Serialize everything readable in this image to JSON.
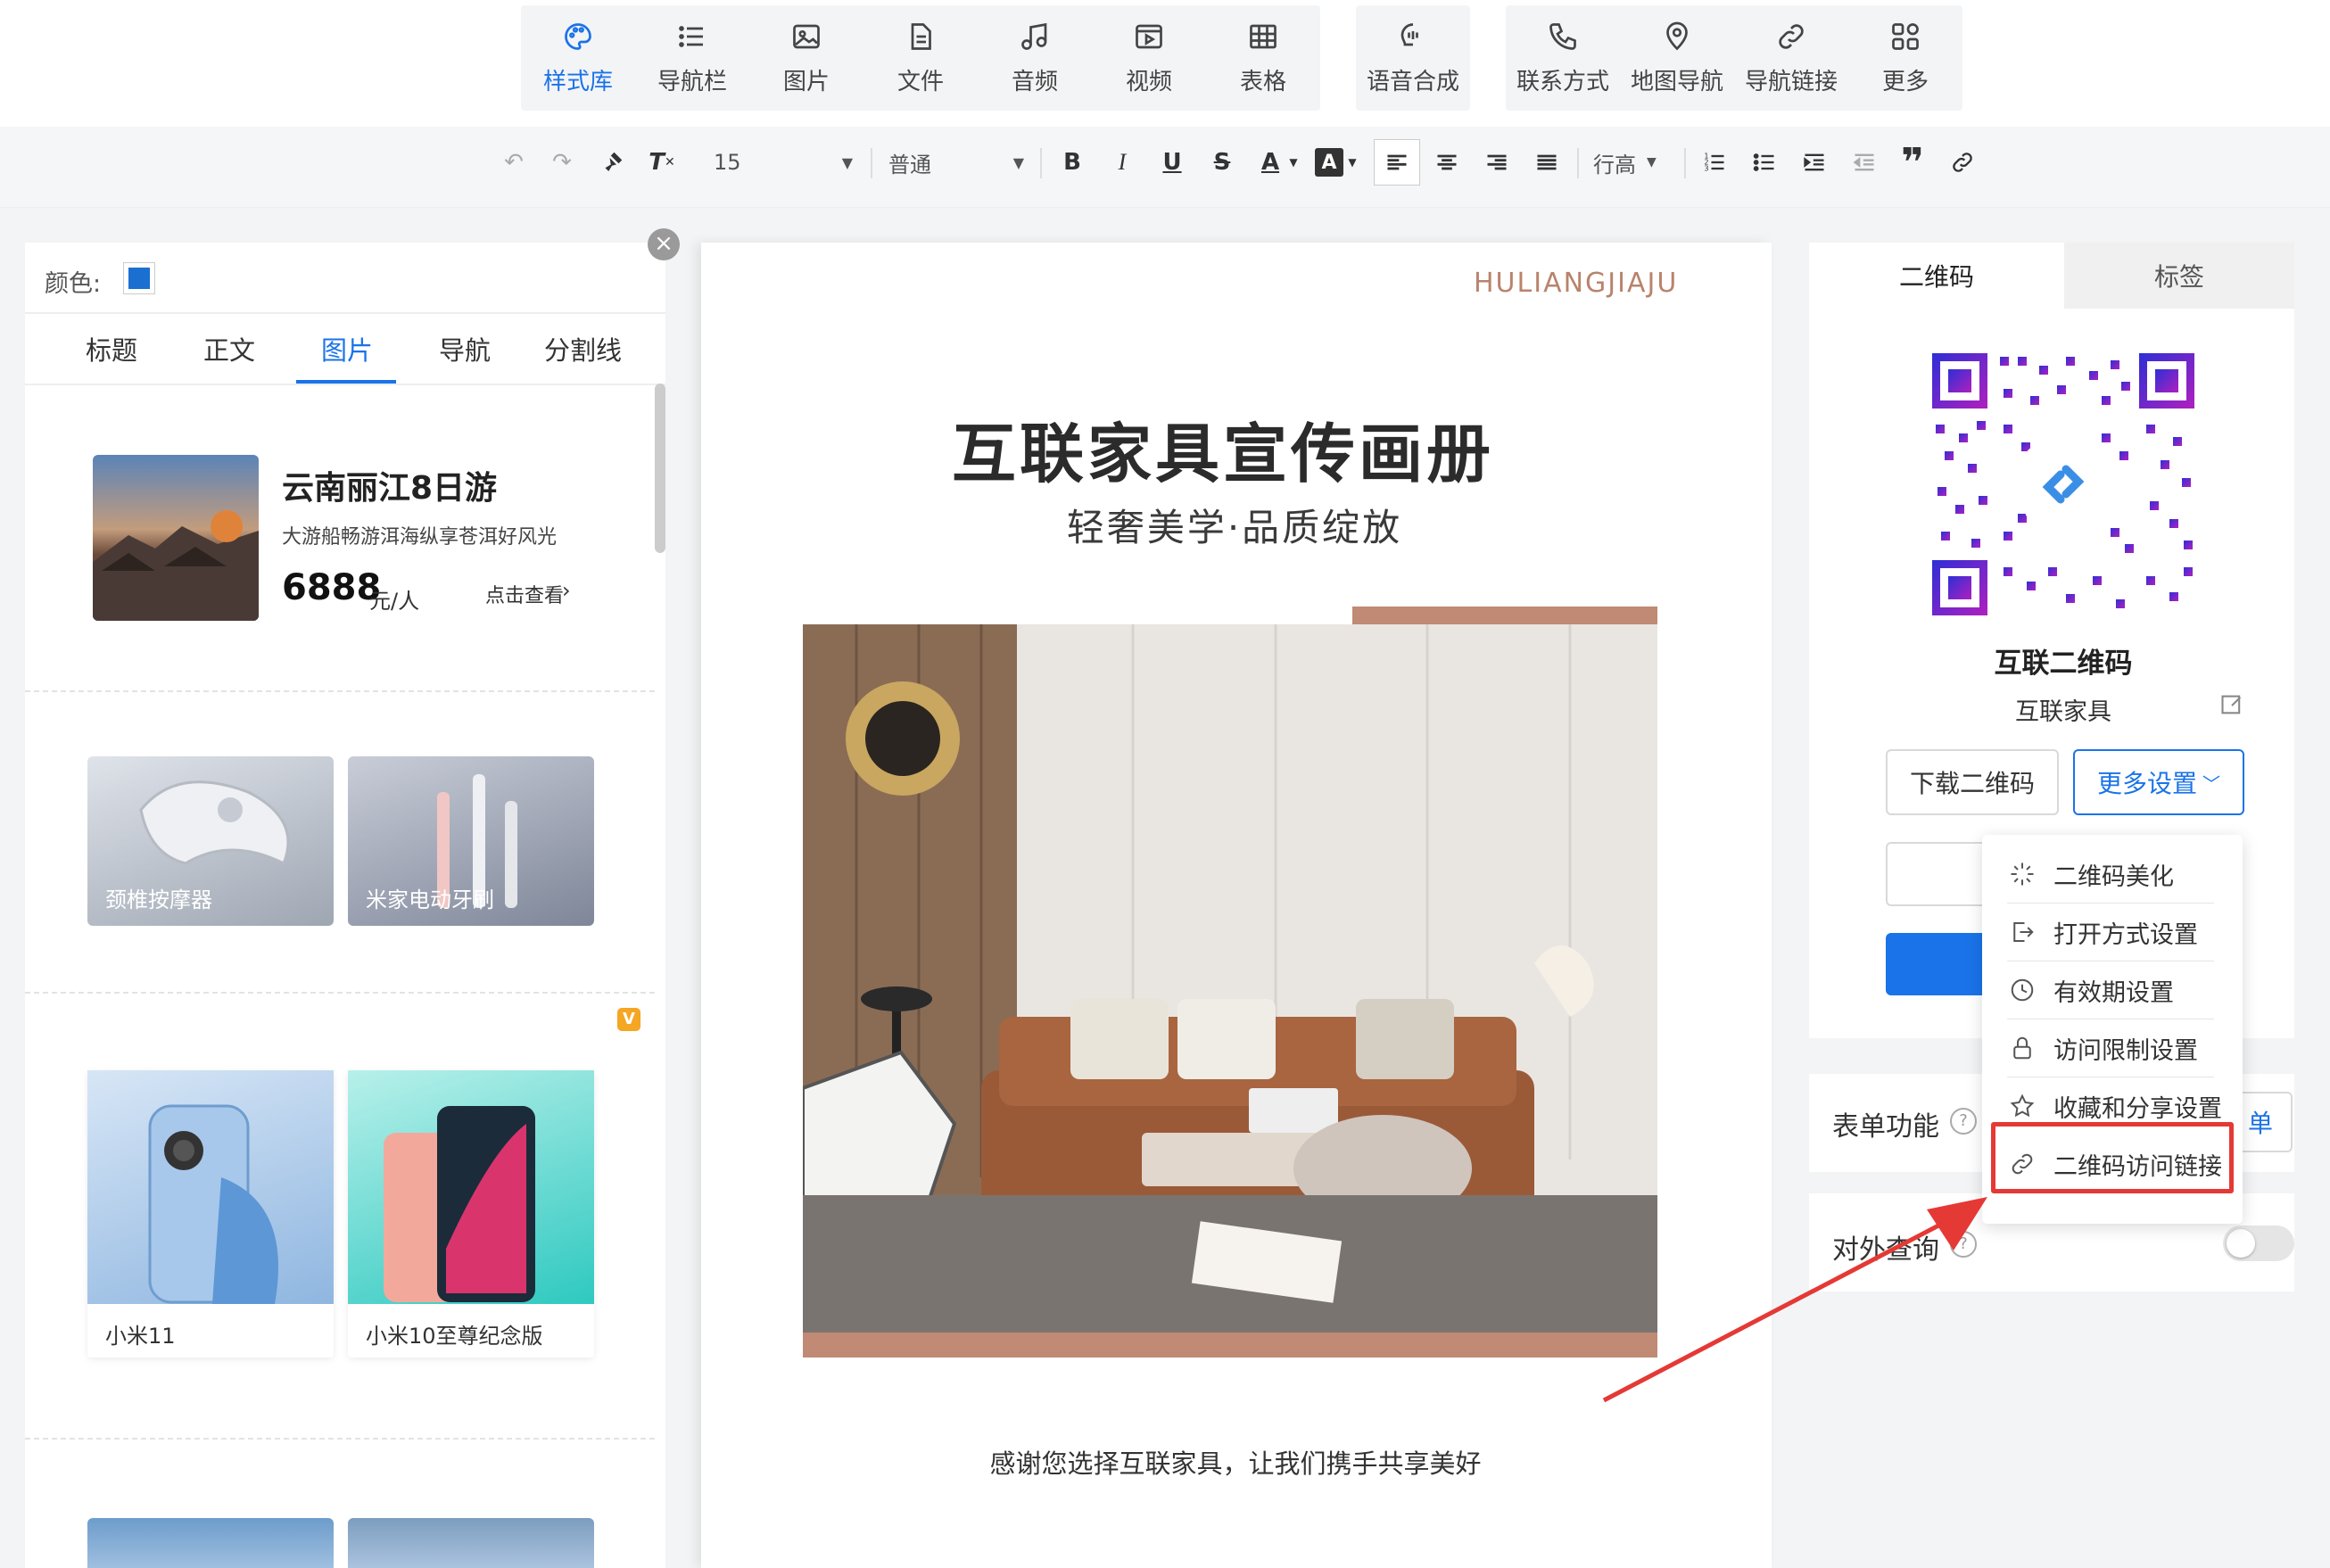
{
  "toolbar": {
    "groups": [
      [
        {
          "label": "样式库",
          "icon": "palette-icon",
          "active": true
        },
        {
          "label": "导航栏",
          "icon": "list-icon"
        },
        {
          "label": "图片",
          "icon": "image-icon"
        },
        {
          "label": "文件",
          "icon": "file-icon"
        },
        {
          "label": "音频",
          "icon": "music-icon"
        },
        {
          "label": "视频",
          "icon": "video-icon"
        },
        {
          "label": "表格",
          "icon": "table-icon"
        }
      ],
      [
        {
          "label": "语音合成",
          "icon": "speech-icon"
        }
      ],
      [
        {
          "label": "联系方式",
          "icon": "phone-icon"
        },
        {
          "label": "地图导航",
          "icon": "map-pin-icon"
        },
        {
          "label": "导航链接",
          "icon": "link-icon"
        },
        {
          "label": "更多",
          "icon": "grid-icon"
        }
      ]
    ]
  },
  "format": {
    "font_size": "15",
    "paragraph_style": "普通",
    "line_height": "行高",
    "bold": "B",
    "italic": "I",
    "underline": "U",
    "strike": "S",
    "font_color": "A",
    "bg_color": "A",
    "quote": "❞"
  },
  "left": {
    "color_label": "颜色:",
    "color_value": "#1a6fd1",
    "tabs": [
      "标题",
      "正文",
      "图片",
      "导航",
      "分割线"
    ],
    "active_tab": 2,
    "travel": {
      "title": "云南丽江8日游",
      "subtitle": "大游船畅游洱海纵享苍洱好风光",
      "price": "6888",
      "unit": "元/人",
      "link": "点击查看"
    },
    "products_a": [
      {
        "label": "颈椎按摩器"
      },
      {
        "label": "米家电动牙刷"
      }
    ],
    "products_b": [
      {
        "label": "小米11"
      },
      {
        "label": "小米10至尊纪念版"
      }
    ],
    "vip_badge": "V"
  },
  "canvas": {
    "brand": "HULIANGJIAJU",
    "title": "互联家具宣传画册",
    "subtitle": "轻奢美学·品质绽放",
    "footer": "感谢您选择互联家具，让我们携手共享美好"
  },
  "right": {
    "tabs": [
      "二维码",
      "标签"
    ],
    "qr_title": "互联二维码",
    "qr_name": "互联家具",
    "download_btn": "下载二维码",
    "more_settings_btn": "更多设置",
    "menu": [
      {
        "label": "二维码美化",
        "icon": "sparkle-icon"
      },
      {
        "label": "打开方式设置",
        "icon": "open-external-icon"
      },
      {
        "label": "有效期设置",
        "icon": "clock-icon"
      },
      {
        "label": "访问限制设置",
        "icon": "lock-icon"
      },
      {
        "label": "收藏和分享设置",
        "icon": "star-icon"
      },
      {
        "label": "二维码访问链接",
        "icon": "link-icon"
      }
    ],
    "form_label": "表单功能",
    "form_btn_fragment": "单",
    "public_query_label": "对外查询"
  },
  "colors": {
    "accent": "#1a73e8",
    "highlight_box": "#e53935",
    "banner_brown": "#c08a74",
    "brand_text": "#b9836c"
  }
}
